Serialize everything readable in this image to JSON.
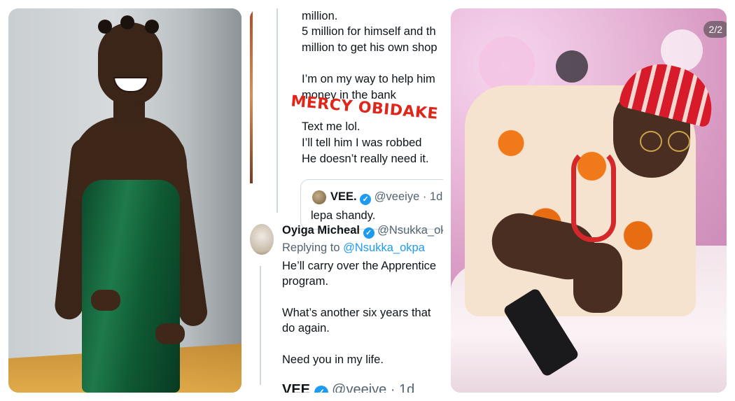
{
  "tweet_panel": {
    "line_1": "million.",
    "line_2": "5 million for himself and th",
    "line_3": "million to get his own shop",
    "line_4": "I’m on my way to help him",
    "line_5": "money in the bank",
    "line_6": "Text me lol.",
    "line_7": "I’ll tell him I was robbed",
    "line_8": "He doesn’t really need it.",
    "watermark": "MERCY OBIDAKE BLOG",
    "quote": {
      "name": "VEE.",
      "handle": "@veeiye · 1d",
      "text": "lepa shandy."
    },
    "reply": {
      "name": "Oyiga Micheal",
      "handle": "@Nsukka_ok",
      "replying_prefix": "Replying to ",
      "replying_to": "@Nsukka_okpa",
      "line_1": "He’ll carry over the Apprentice",
      "line_2": "program.",
      "line_3": "What’s another six years that",
      "line_4": "do again.",
      "line_5": "Need you in my life."
    },
    "next_tweet": {
      "name": "VEE",
      "handle": "@veeiye · 1d"
    }
  },
  "right_photo": {
    "page_indicator": "2/2"
  },
  "colors": {
    "verified_blue": "#1d9bf0",
    "watermark_red": "#e0261b",
    "dress_green": "#1f7a4a"
  }
}
